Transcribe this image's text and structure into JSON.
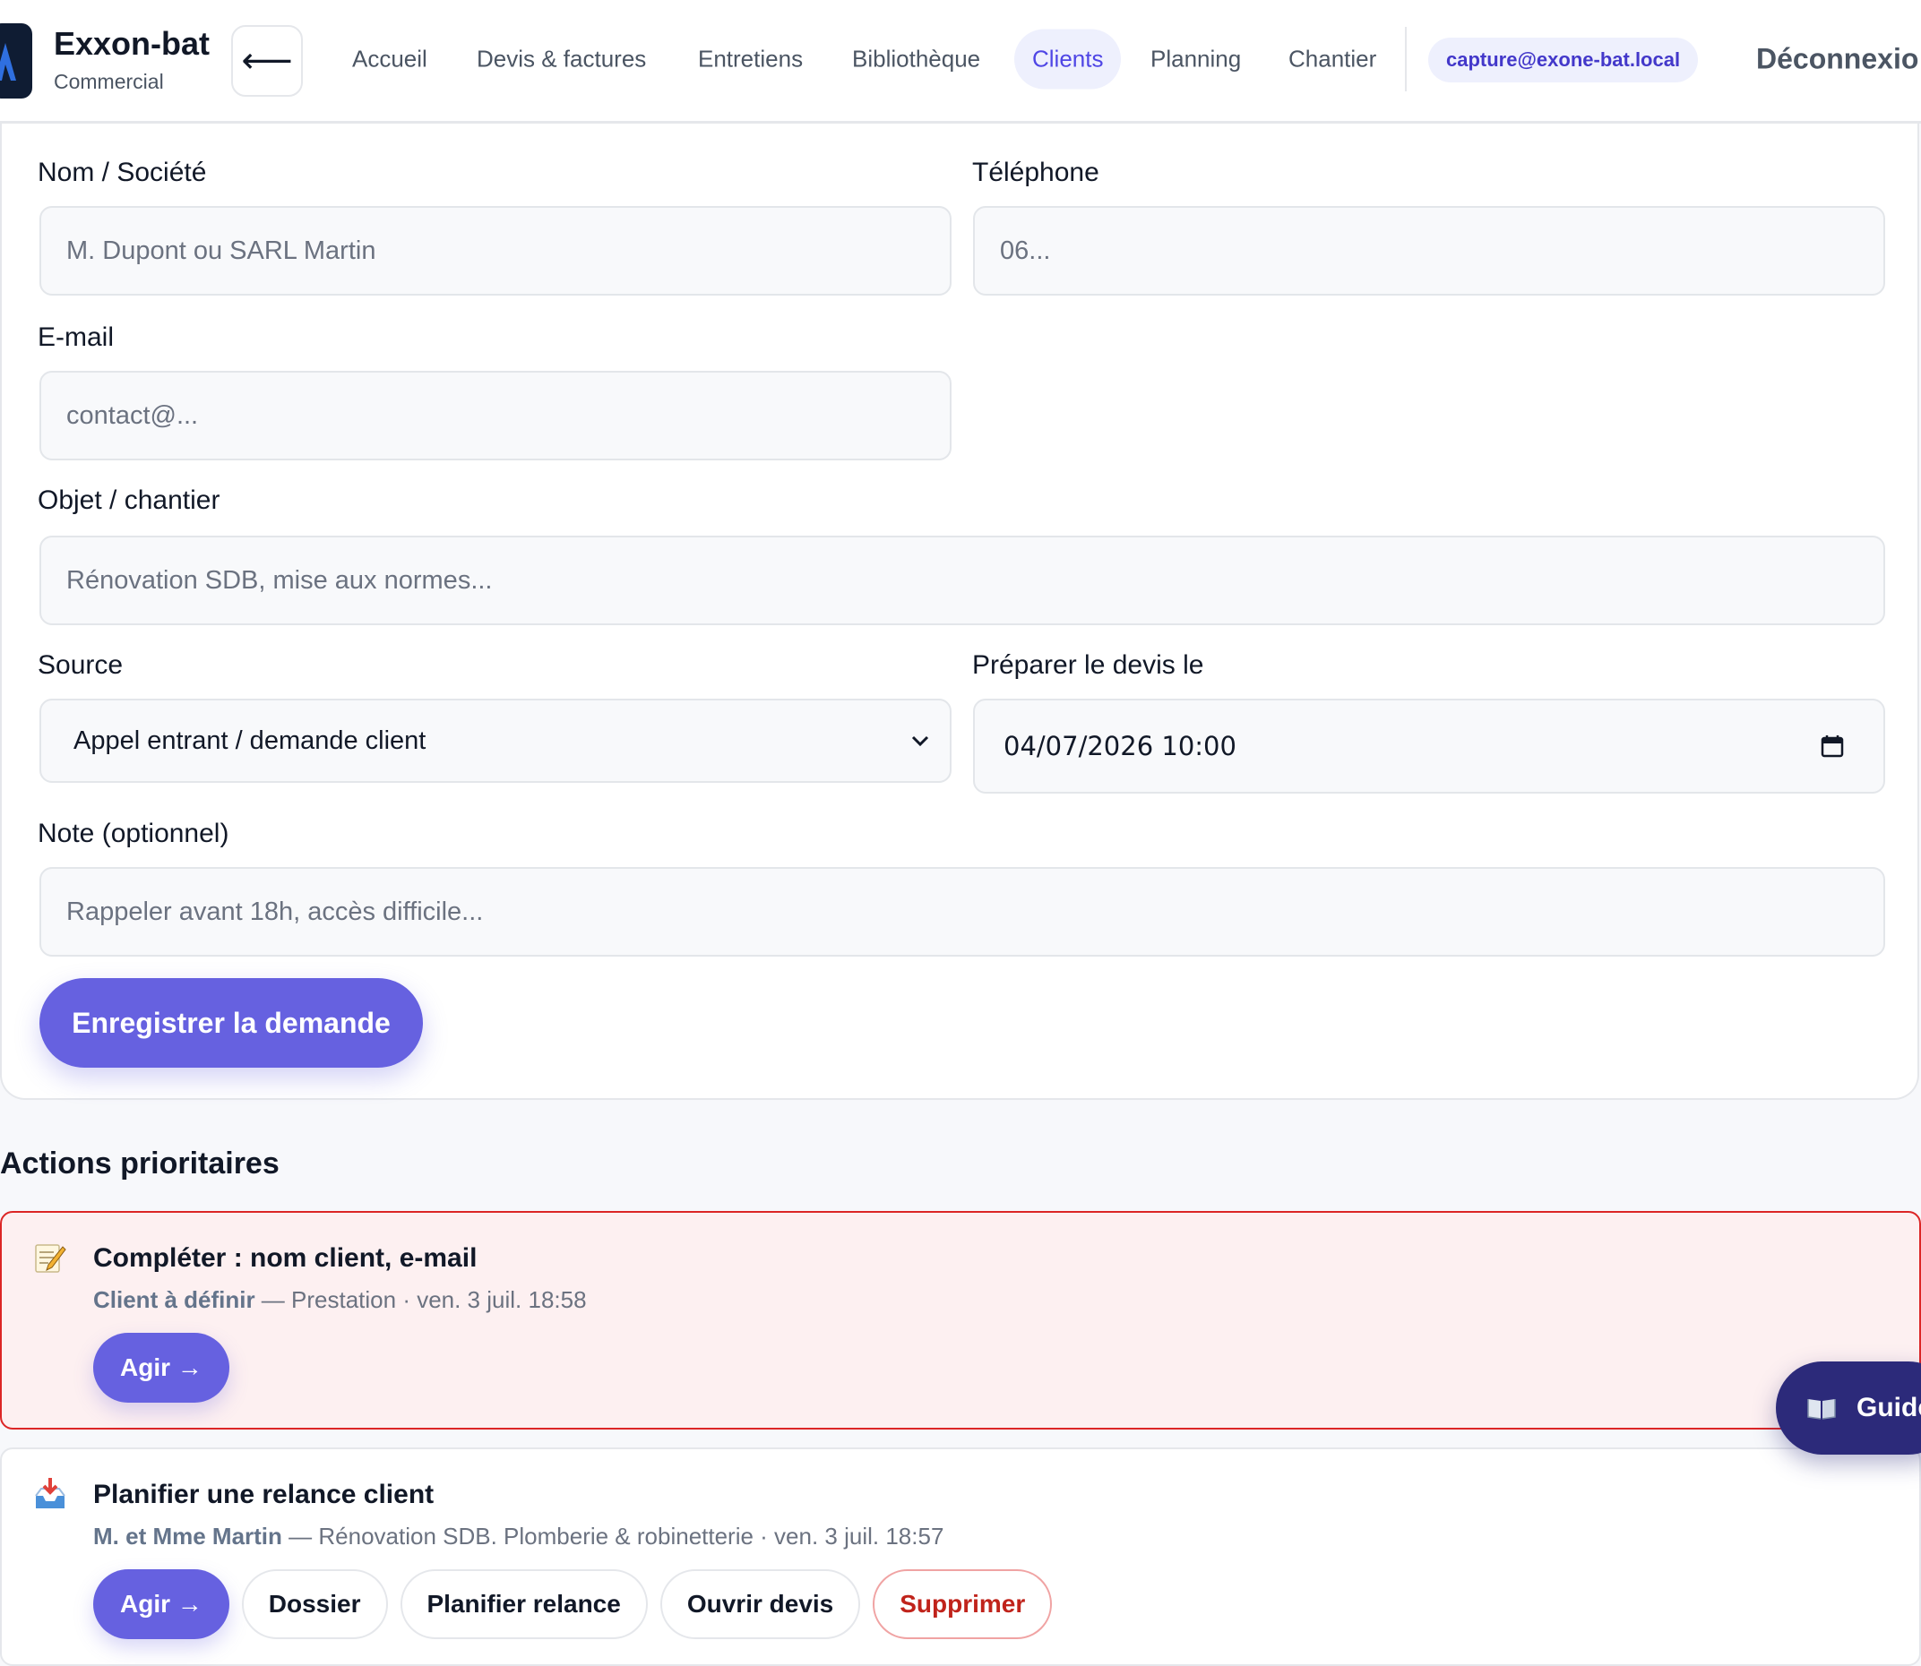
{
  "app": {
    "brand_name": "Exxon-bat",
    "brand_role": "Commercial",
    "back_icon": "arrow-left-icon"
  },
  "nav": {
    "items": [
      {
        "label": "Accueil"
      },
      {
        "label": "Devis & factures"
      },
      {
        "label": "Entretiens"
      },
      {
        "label": "Bibliothèque"
      },
      {
        "label": "Clients",
        "active": true
      },
      {
        "label": "Planning"
      },
      {
        "label": "Chantier"
      }
    ],
    "user_email": "capture@exone-bat.local",
    "logout_label": "Déconnexio"
  },
  "form": {
    "name": {
      "label": "Nom / Société",
      "placeholder": "M. Dupont ou SARL Martin",
      "value": ""
    },
    "phone": {
      "label": "Téléphone",
      "placeholder": "06...",
      "value": ""
    },
    "email": {
      "label": "E-mail",
      "placeholder": "contact@...",
      "value": ""
    },
    "subject": {
      "label": "Objet / chantier",
      "placeholder": "Rénovation SDB, mise aux normes...",
      "value": ""
    },
    "source": {
      "label": "Source",
      "value": "Appel entrant / demande client"
    },
    "quote_date": {
      "label": "Préparer le devis le",
      "value": "04/07/2026 10:00"
    },
    "note": {
      "label": "Note (optionnel)",
      "placeholder": "Rappeler avant 18h, accès difficile...",
      "value": ""
    },
    "submit_label": "Enregistrer la demande"
  },
  "actions": {
    "title": "Actions prioritaires",
    "items": [
      {
        "icon": "memo-pencil-icon",
        "title": "Compléter : nom client, e-mail",
        "client": "Client à définir",
        "details": " — Prestation · ven. 3 juil. 18:58",
        "buttons": {
          "agir": "Agir →"
        }
      },
      {
        "icon": "inbox-tray-icon",
        "title": "Planifier une relance client",
        "client": "M. et Mme Martin",
        "details": " — Rénovation SDB. Plomberie & robinetterie · ven. 3 juil. 18:57",
        "buttons": {
          "agir": "Agir →",
          "dossier": "Dossier",
          "relance": "Planifier relance",
          "devis": "Ouvrir devis",
          "delete": "Supprimer"
        }
      }
    ]
  },
  "guide": {
    "label": "Guide",
    "icon": "open-book-icon"
  },
  "colors": {
    "accent": "#6661e0",
    "accent_text": "#4f46e5",
    "urgent_border": "#dc2626",
    "urgent_bg": "#fdf0f1",
    "danger_text": "#c0231b",
    "guide_bg": "#2c2a7a"
  }
}
